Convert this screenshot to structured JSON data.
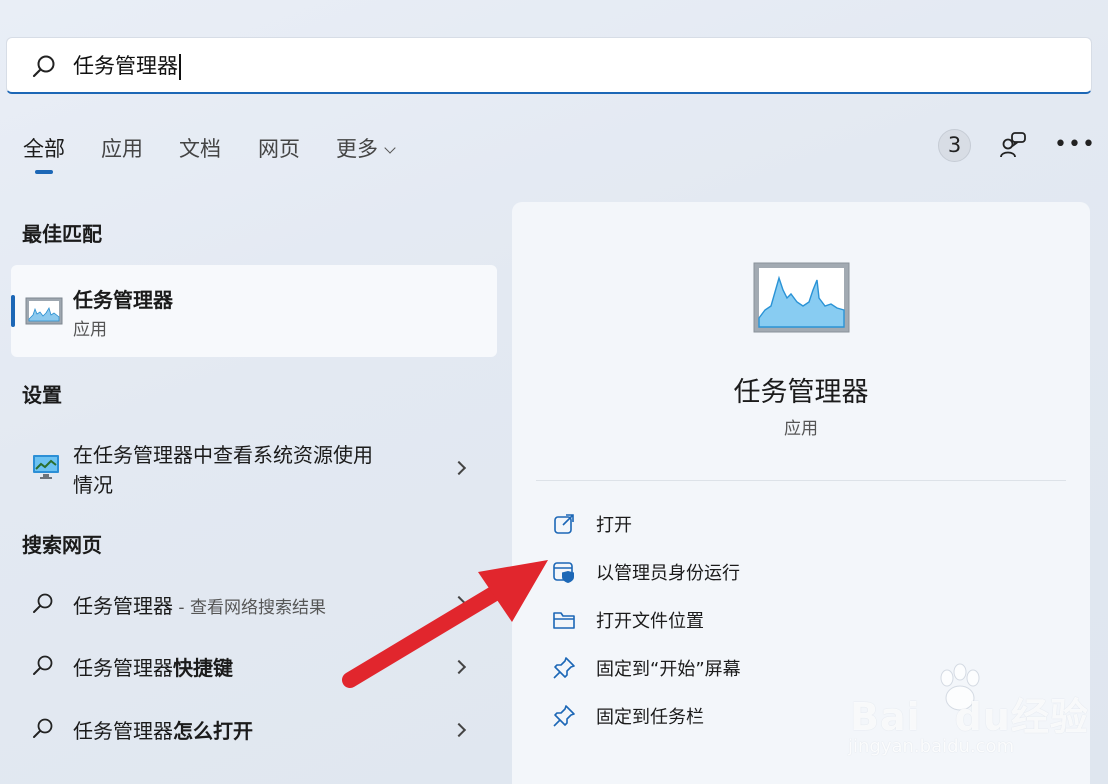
{
  "search": {
    "query": "任务管理器"
  },
  "tabs": [
    {
      "label": "全部",
      "active": true
    },
    {
      "label": "应用"
    },
    {
      "label": "文档"
    },
    {
      "label": "网页"
    },
    {
      "label": "更多"
    }
  ],
  "header": {
    "badge_count": "3"
  },
  "sections": {
    "best_match": "最佳匹配",
    "settings": "设置",
    "web": "搜索网页"
  },
  "best_match": {
    "name": "任务管理器",
    "type": "应用"
  },
  "settings_item": {
    "line1": "在任务管理器中查看系统资源使用",
    "line2": "情况"
  },
  "web_results": [
    {
      "query": "任务管理器",
      "suffix": " - 查看网络搜索结果"
    },
    {
      "query": "任务管理器",
      "bold": "快捷键"
    },
    {
      "query": "任务管理器",
      "bold": "怎么打开"
    }
  ],
  "detail": {
    "name": "任务管理器",
    "type": "应用",
    "actions": [
      {
        "label": "打开",
        "icon": "open-external-icon"
      },
      {
        "label": "以管理员身份运行",
        "icon": "admin-shield-icon"
      },
      {
        "label": "打开文件位置",
        "icon": "folder-icon"
      },
      {
        "label": "固定到“开始”屏幕",
        "icon": "pin-icon"
      },
      {
        "label": "固定到任务栏",
        "icon": "pin-icon"
      }
    ]
  },
  "watermark": {
    "brand": "Bai",
    "brand2": "du",
    "cn": "经验",
    "url": "jingyan.baidu.com"
  },
  "colors": {
    "accent": "#1c67b6",
    "arrow": "#e1262d"
  }
}
